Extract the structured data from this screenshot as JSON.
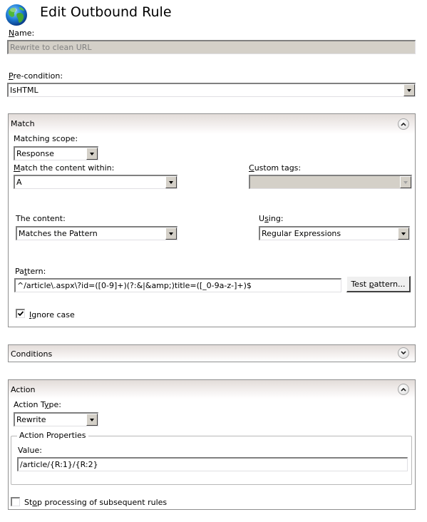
{
  "header": {
    "title": "Edit Outbound Rule",
    "icon": "globe-icon"
  },
  "name": {
    "label": "Name:",
    "label_accel": "N",
    "label_rest": "ame:",
    "value": "Rewrite to clean URL"
  },
  "precondition": {
    "label_accel": "P",
    "label_rest": "re-condition:",
    "value": "IsHTML"
  },
  "match": {
    "title": "Match",
    "expanded": true,
    "matching_scope": {
      "label": "Matching scope:",
      "value": "Response"
    },
    "match_within": {
      "label_accel": "M",
      "label_rest": "atch the content within:",
      "value": "A"
    },
    "custom_tags": {
      "label_accel": "C",
      "label_rest": "ustom tags:",
      "value": "",
      "disabled": true
    },
    "the_content": {
      "label": "The content:",
      "value": "Matches the Pattern"
    },
    "using": {
      "label_pre": "U",
      "label_accel": "s",
      "label_rest": "ing:",
      "value": "Regular Expressions"
    },
    "pattern": {
      "label_pre": "Pa",
      "label_accel": "t",
      "label_rest": "tern:",
      "value": "^/article\\.aspx\\?id=([0-9]+)(?:&|&amp;)title=([_0-9a-z-]+)$"
    },
    "test_pattern_button": {
      "label_pre": "Test ",
      "label_accel": "p",
      "label_rest": "attern..."
    },
    "ignore_case": {
      "label_accel": "I",
      "label_rest": "gnore case",
      "checked": true
    }
  },
  "conditions": {
    "title": "Conditions",
    "expanded": false
  },
  "action": {
    "title": "Action",
    "expanded": true,
    "action_type": {
      "label_pre": "Action T",
      "label_accel": "y",
      "label_rest": "pe:",
      "value": "Rewrite"
    },
    "properties": {
      "legend": "Action Properties",
      "value_label": "Value:",
      "value": "/article/{R:1}/{R:2}"
    },
    "stop_processing": {
      "label_pre": "St",
      "label_accel": "o",
      "label_rest": "p processing of subsequent rules",
      "checked": false
    }
  }
}
